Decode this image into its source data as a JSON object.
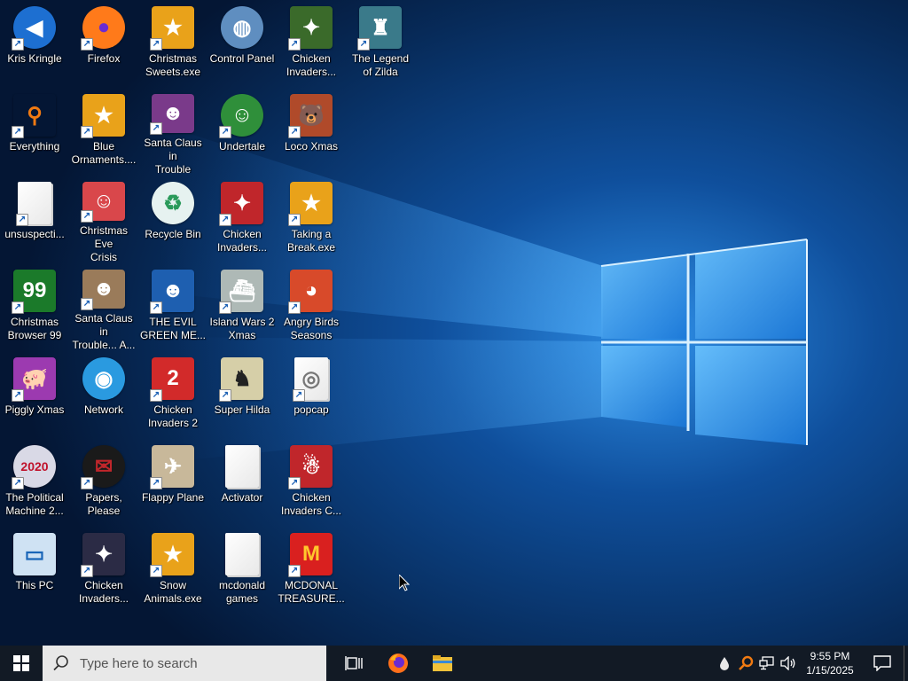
{
  "desktop": {
    "icons": [
      {
        "label": "Kris Kringle",
        "glyph": "◀",
        "style": "round",
        "bg": "#1d6fd1"
      },
      {
        "label": "Everything",
        "glyph": "⚲",
        "style": "plain",
        "bg": "transparent",
        "fg": "#f07a12"
      },
      {
        "label": "unsuspecti...",
        "glyph": "",
        "style": "file"
      },
      {
        "label": "Christmas\nBrowser 99",
        "glyph": "99",
        "style": "plain",
        "bg": "#1b7a2a"
      },
      {
        "label": "Piggly Xmas",
        "glyph": "🐖",
        "style": "plain",
        "bg": "#9c3ab0"
      },
      {
        "label": "The Political\nMachine 2...",
        "glyph": "2020",
        "style": "round",
        "bg": "#d9d9e6",
        "fg": "#c0122b"
      },
      {
        "label": "This PC",
        "glyph": "▭",
        "style": "plain",
        "bg": "#cfe2f3",
        "fg": "#1a66b8"
      },
      {
        "label": "Firefox",
        "glyph": "●",
        "style": "round",
        "bg": "#ff7a1a",
        "fg": "#6b2bd1"
      },
      {
        "label": "Blue\nOrnaments....",
        "glyph": "★",
        "style": "plain",
        "bg": "#e9a21a"
      },
      {
        "label": "Christmas Eve\nCrisis",
        "glyph": "☺",
        "style": "plain",
        "bg": "#d9474b"
      },
      {
        "label": "Santa Claus in\nTrouble... A...",
        "glyph": "☻",
        "style": "plain",
        "bg": "#9a7b5a"
      },
      {
        "label": "Network",
        "glyph": "◉",
        "style": "round",
        "bg": "#2a9ae0"
      },
      {
        "label": "Papers, Please",
        "glyph": "✉",
        "style": "round",
        "bg": "#1a1a1a",
        "fg": "#c0262b"
      },
      {
        "label": "Chicken\nInvaders...",
        "glyph": "✦",
        "style": "plain",
        "bg": "#2b2b45"
      },
      {
        "label": "Christmas\nSweets.exe",
        "glyph": "★",
        "style": "plain",
        "bg": "#e9a21a"
      },
      {
        "label": "Santa Claus in\nTrouble",
        "glyph": "☻",
        "style": "plain",
        "bg": "#7a3a8a"
      },
      {
        "label": "Recycle Bin",
        "glyph": "♻",
        "style": "round",
        "bg": "#e6f2f0",
        "fg": "#2a9a5a"
      },
      {
        "label": "THE EVIL\nGREEN ME...",
        "glyph": "☻",
        "style": "plain",
        "bg": "#1e5fb0"
      },
      {
        "label": "Chicken\nInvaders 2",
        "glyph": "2",
        "style": "plain",
        "bg": "#d22a2a"
      },
      {
        "label": "Flappy Plane",
        "glyph": "✈",
        "style": "plain",
        "bg": "#c8b89a"
      },
      {
        "label": "Snow\nAnimals.exe",
        "glyph": "★",
        "style": "plain",
        "bg": "#e9a21a"
      },
      {
        "label": "Control Panel",
        "glyph": "◍",
        "style": "round",
        "bg": "#5f8ec0"
      },
      {
        "label": "Undertale",
        "glyph": "☺",
        "style": "round",
        "bg": "#2f8f3a"
      },
      {
        "label": "Chicken\nInvaders...",
        "glyph": "✦",
        "style": "plain",
        "bg": "#c0262b"
      },
      {
        "label": "Island Wars 2\nXmas",
        "glyph": "⛴",
        "style": "plain",
        "bg": "#aeb9b6"
      },
      {
        "label": "Super Hilda",
        "glyph": "♞",
        "style": "plain",
        "bg": "#d6cfa8",
        "fg": "#222"
      },
      {
        "label": "Activator",
        "glyph": "",
        "style": "file"
      },
      {
        "label": "mcdonald\ngames",
        "glyph": "",
        "style": "file"
      },
      {
        "label": "Chicken\nInvaders...",
        "glyph": "✦",
        "style": "plain",
        "bg": "#3a6a2a"
      },
      {
        "label": "Loco Xmas",
        "glyph": "🐻",
        "style": "plain",
        "bg": "#b04a2a"
      },
      {
        "label": "Taking a\nBreak.exe",
        "glyph": "★",
        "style": "plain",
        "bg": "#e9a21a"
      },
      {
        "label": "Angry Birds\nSeasons",
        "glyph": "◕",
        "style": "plain",
        "bg": "#d84a2a"
      },
      {
        "label": "popcap",
        "glyph": "◎",
        "style": "file"
      },
      {
        "label": "Chicken\nInvaders C...",
        "glyph": "☃",
        "style": "plain",
        "bg": "#c0262b"
      },
      {
        "label": "MCDONAL\nTREASURE...",
        "glyph": "M",
        "style": "plain",
        "bg": "#d9201f",
        "fg": "#ffc72c"
      },
      {
        "label": "The Legend\nof Zilda",
        "glyph": "♜",
        "style": "plain",
        "bg": "#3a7a8a"
      }
    ]
  },
  "taskbar": {
    "search_placeholder": "Type here to search",
    "clock_time": "9:55 PM",
    "clock_date": "1/15/2025"
  },
  "icons": {
    "start": "windows-logo-icon",
    "search": "search-icon",
    "task_view": "task-view-icon",
    "firefox": "firefox-icon",
    "file_explorer": "folder-icon",
    "tray": [
      "water-drop-icon",
      "everything-search-icon",
      "network-icon",
      "volume-icon"
    ],
    "notification": "notification-icon"
  },
  "colors": {
    "taskbar": "#121a25",
    "search_box": "#e8e8e8",
    "wallpaper_glow": "#3aa6ff"
  }
}
